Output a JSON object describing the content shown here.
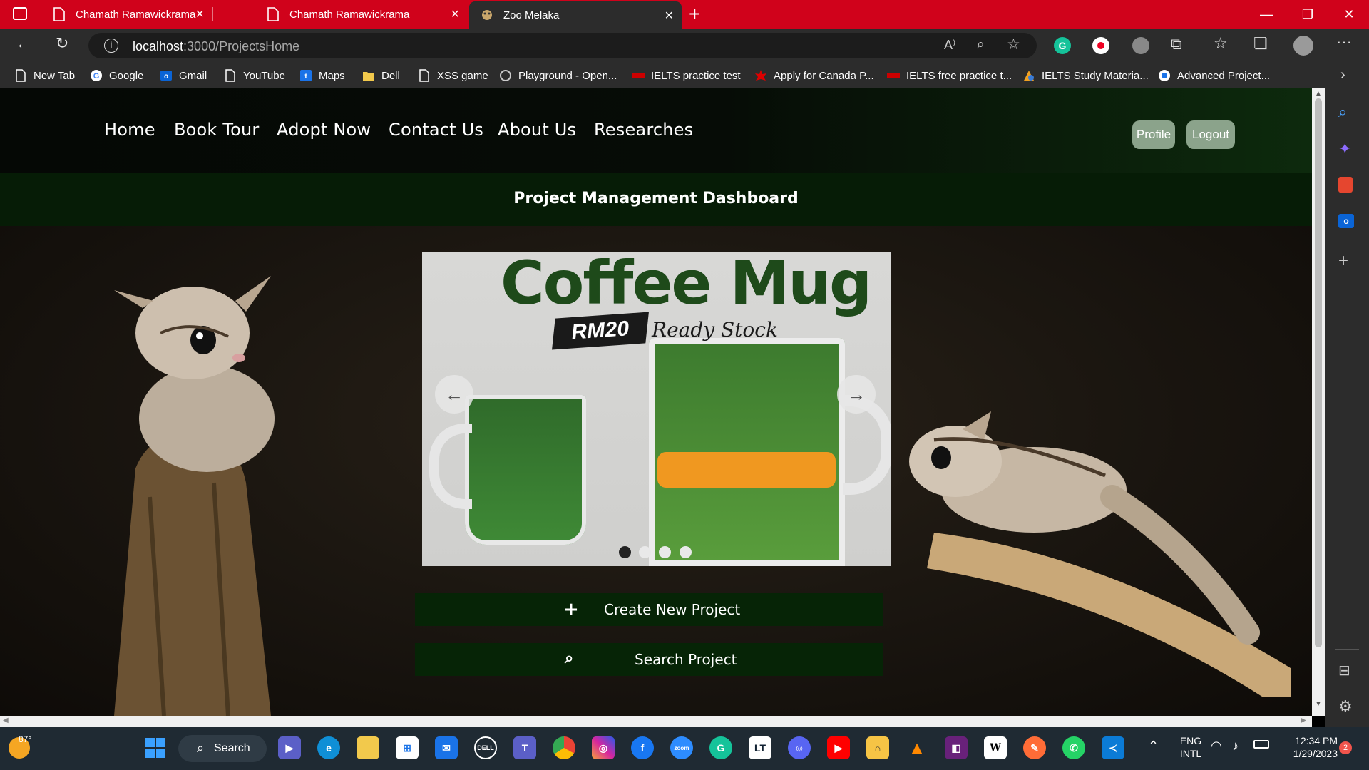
{
  "browser": {
    "tabs": [
      {
        "label": "Chamath Ramawickrama",
        "active": false
      },
      {
        "label": "Chamath Ramawickrama",
        "active": false
      },
      {
        "label": "Zoo Melaka",
        "active": true
      }
    ],
    "url_host": "localhost",
    "url_path": ":3000/ProjectsHome",
    "bookmarks": [
      "New Tab",
      "Google",
      "Gmail",
      "YouTube",
      "Maps",
      "Dell",
      "XSS game",
      "Playground - Open...",
      "IELTS practice test",
      "Apply for Canada P...",
      "IELTS free practice t...",
      "IELTS Study Materia...",
      "Advanced Project..."
    ]
  },
  "nav": {
    "links": [
      "Home",
      "Book Tour",
      "Adopt Now",
      "Contact Us",
      "About Us",
      "Researches"
    ],
    "profile": "Profile",
    "logout": "Logout"
  },
  "dashboard": {
    "title": "Project Management Dashboard"
  },
  "slider": {
    "headline": "Coffee Mug",
    "price": "RM20",
    "stock": "Ready Stock",
    "active_slide": 1,
    "slide_count": 4
  },
  "actions": {
    "create": "Create New Project",
    "search": "Search Project"
  },
  "taskbar": {
    "weather": "87°",
    "search": "Search",
    "lang1": "ENG",
    "lang2": "INTL",
    "time": "12:34 PM",
    "date": "1/29/2023",
    "notifications": "2"
  }
}
